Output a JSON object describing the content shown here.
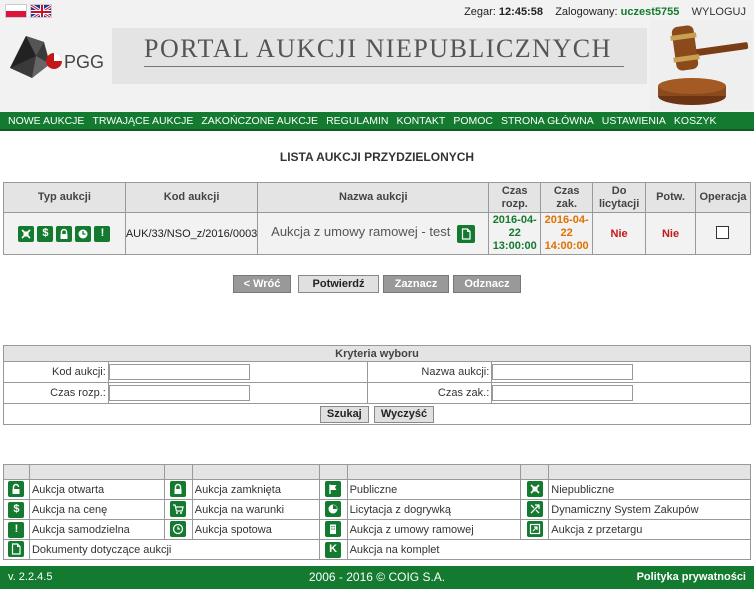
{
  "header": {
    "clock_label": "Zegar:",
    "clock_value": "12:45:58",
    "logged_label": "Zalogowany:",
    "user": "uczest5755",
    "logout": "WYLOGUJ",
    "logo_text": "PGG",
    "title": "PORTAL AUKCJI NIEPUBLICZNYCH"
  },
  "nav": {
    "items": [
      "NOWE AUKCJE",
      "TRWAJĄCE AUKCJE",
      "ZAKOŃCZONE AUKCJE",
      "REGULAMIN",
      "KONTAKT",
      "POMOC",
      "STRONA GŁÓWNA",
      "USTAWIENIA",
      "KOSZYK"
    ]
  },
  "section_title": "LISTA AUKCJI PRZYDZIELONYCH",
  "table": {
    "headers": [
      "Typ aukcji",
      "Kod aukcji",
      "Nazwa aukcji",
      "Czas rozp.",
      "Czas zak.",
      "Do licytacji",
      "Potw.",
      "Operacja"
    ],
    "row": {
      "kod": "AUK/33/NSO_z/2016/0003",
      "nazwa": "Aukcja z umowy ramowej - test",
      "start_date": "2016-04-22",
      "start_time": "13:00:00",
      "end_date": "2016-04-22",
      "end_time": "14:00:00",
      "do_licytacji": "Nie",
      "potw": "Nie"
    }
  },
  "buttons": {
    "back": "< Wróć",
    "confirm": "Potwierdź",
    "select": "Zaznacz",
    "deselect": "Odznacz"
  },
  "filter": {
    "title": "Kryteria wyboru",
    "kod_label": "Kod aukcji:",
    "nazwa_label": "Nazwa aukcji:",
    "start_label": "Czas rozp.:",
    "end_label": "Czas zak.:",
    "search": "Szukaj",
    "clear": "Wyczyść"
  },
  "legend": {
    "aukcja_otwarta": "Aukcja otwarta",
    "aukcja_zamknieta": "Aukcja zamknięta",
    "publiczne": "Publiczne",
    "niepubliczne": "Niepubliczne",
    "aukcja_na_cene": "Aukcja na cenę",
    "aukcja_na_warunki": "Aukcja na warunki",
    "licytacja_z_dogrywka": "Licytacja z dogrywką",
    "dynamiczny_system": "Dynamiczny System Zakupów",
    "aukcja_samodzielna": "Aukcja samodzielna",
    "aukcja_spotowa": "Aukcja spotowa",
    "aukcja_z_umowy_ramowej": "Aukcja z umowy ramowej",
    "aukcja_z_przetargu": "Aukcja z przetargu",
    "dokumenty": "Dokumenty dotyczące aukcji",
    "aukcja_na_komplet": "Aukcja na komplet"
  },
  "footer": {
    "version": "v. 2.2.4.5",
    "copyright": "2006 - 2016 © COIG S.A.",
    "policy": "Polityka prywatności"
  },
  "colors": {
    "accent_green": "#137a2f",
    "start_date": "#137a2f",
    "end_date": "#e07000",
    "nie": "#c41818"
  }
}
